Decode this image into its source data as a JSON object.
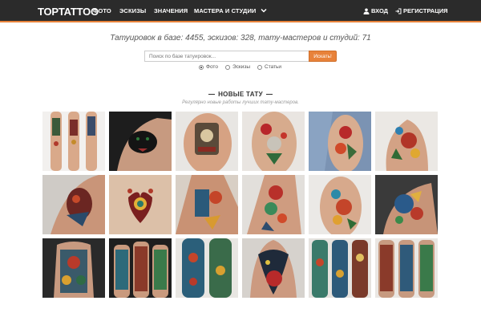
{
  "header": {
    "logo": "TOPTATTOO",
    "nav": [
      "ФОТО",
      "ЭСКИЗЫ",
      "ЗНАЧЕНИЯ",
      "МАСТЕРА И СТУДИИ"
    ],
    "login": "ВХОД",
    "register": "РЕГИСТРАЦИЯ",
    "accent": "#e8823a",
    "bg": "#2b2b2b"
  },
  "stats": "Татуировок в базе: 4455, эскизов: 328, тату-мастеров и студий: 71",
  "search": {
    "placeholder": "Поиск по базе татуировок...",
    "button": "Искать!",
    "options": [
      "Фото",
      "Эскизы",
      "Статьи"
    ],
    "selected": "Фото"
  },
  "section": {
    "title": "НОВЫЕ ТАТУ",
    "subtitle": "Регулярно новые работы лучших тату-мастеров."
  }
}
